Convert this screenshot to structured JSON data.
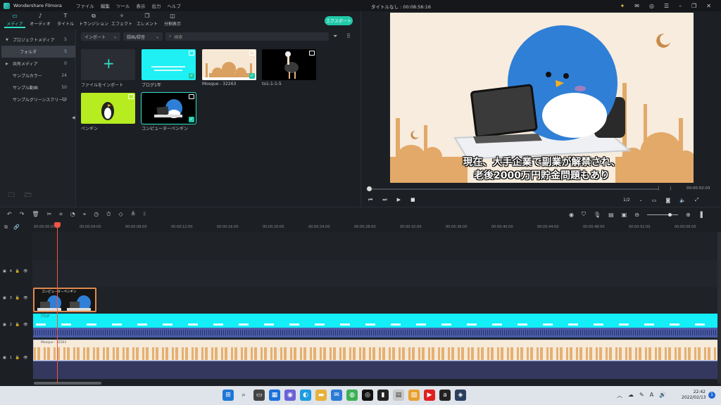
{
  "app": {
    "name": "Wondershare Filmora",
    "menu": [
      "ファイル",
      "編集",
      "ツール",
      "表示",
      "出力",
      "ヘルプ"
    ],
    "doc_title": "タイトルなし : 00:08:56:16"
  },
  "toolbar": {
    "tabs": [
      {
        "icon": "folder-icon",
        "label": "メディア"
      },
      {
        "icon": "music-note-icon",
        "label": "オーディオ"
      },
      {
        "icon": "text-icon",
        "label": "タイトル"
      },
      {
        "icon": "transition-icon",
        "label": "トランジション"
      },
      {
        "icon": "effect-icon",
        "label": "エフェクト"
      },
      {
        "icon": "element-icon",
        "label": "エレメント"
      },
      {
        "icon": "split-screen-icon",
        "label": "分割表示"
      }
    ],
    "export_label": "エクスポート"
  },
  "sidebar": {
    "items": [
      {
        "label": "プロジェクトメディア",
        "count": "5"
      },
      {
        "label": "フォルダ",
        "count": "5"
      },
      {
        "label": "共有メディア",
        "count": "0"
      },
      {
        "label": "サンプルカラー",
        "count": "24"
      },
      {
        "label": "サンプル動画",
        "count": "50"
      },
      {
        "label": "サンプルグリーンスクリーン",
        "count": "10"
      }
    ]
  },
  "media": {
    "import_label": "インポート",
    "record_label": "録画/録音",
    "search_placeholder": "検索",
    "import_tile_label": "ファイルをインポート",
    "items": [
      {
        "label": "ブログ1年"
      },
      {
        "label": "Mosque - 32263"
      },
      {
        "label": "to1-1-1-5"
      },
      {
        "label": "ペンギン"
      },
      {
        "label": "コンピューターペンギン"
      }
    ]
  },
  "preview": {
    "caption_line1": "現在、大手企業で副業が解禁され、",
    "caption_line2": "老後2000万円貯金問題もあり",
    "timecode": "00:00:02:03",
    "quality": "1/2"
  },
  "timeline": {
    "ruler": [
      "00:00:00:00",
      "00:00:04:00",
      "00:00:08:00",
      "00:00:12:00",
      "00:00:16:00",
      "00:00:20:00",
      "00:00:24:00",
      "00:00:28:00",
      "00:00:32:00",
      "00:00:36:00",
      "00:00:40:00",
      "00:00:44:00",
      "00:00:48:00",
      "00:00:52:00",
      "00:00:56:00"
    ],
    "tracks": [
      {
        "num": "4"
      },
      {
        "num": "3"
      },
      {
        "num": "2"
      },
      {
        "num": "1"
      }
    ],
    "clips": {
      "video_clip": "コンピューターペンギン",
      "title_clip": "ブログ",
      "audio_clip": "Mosque - 32263"
    }
  },
  "taskbar": {
    "time": "22:42",
    "date": "2022/02/13",
    "notifications": "1"
  }
}
